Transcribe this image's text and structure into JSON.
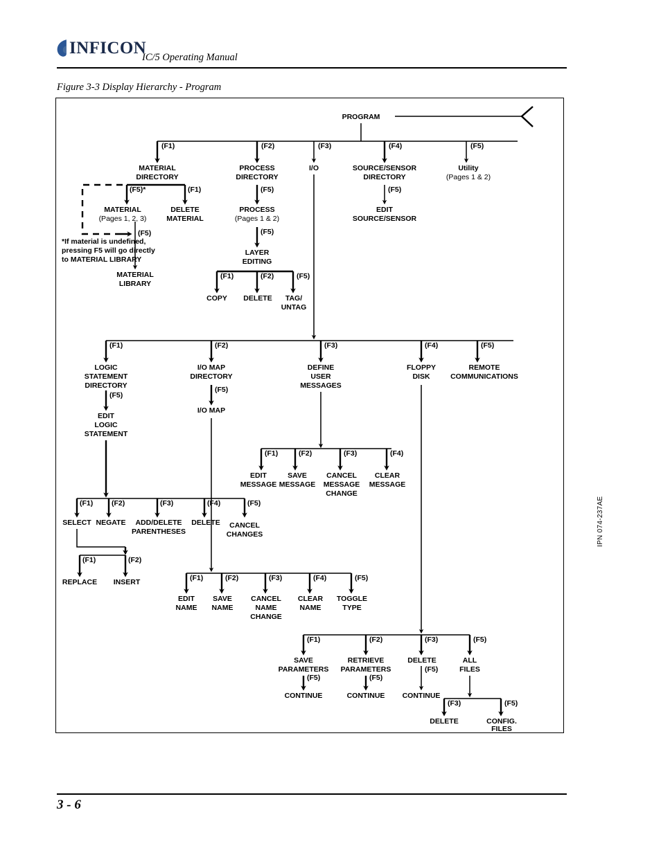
{
  "header": {
    "brand": "INFICON",
    "manual_title": "IC/5 Operating Manual",
    "logo_color": "#2b5796",
    "wordmark_color": "#1b2b4b"
  },
  "figure": {
    "caption": "Figure 3-3  Display Hierarchy - Program",
    "footnote_line1": "*If material is undefined,",
    "footnote_line2": "pressing F5 will go directly",
    "footnote_line3": "to MATERIAL LIBRARY"
  },
  "footer": {
    "page_number": "3 - 6",
    "side_code": "IPN 074-237AE"
  },
  "keys": {
    "f1": "(F1)",
    "f2": "(F2)",
    "f3": "(F3)",
    "f4": "(F4)",
    "f5": "(F5)",
    "f5_star": "(F5)*"
  },
  "nodes": {
    "program": "PROGRAM",
    "material_directory_l1": "MATERIAL",
    "material_directory_l2": "DIRECTORY",
    "process_directory_l1": "PROCESS",
    "process_directory_l2": "DIRECTORY",
    "io": "I/O",
    "source_sensor_directory_l1": "SOURCE/SENSOR",
    "source_sensor_directory_l2": "DIRECTORY",
    "utility_l1": "Utility",
    "utility_l2": "(Pages 1 & 2)",
    "material_l1": "MATERIAL",
    "material_l2": "(Pages 1, 2, 3)",
    "delete_material_l1": "DELETE",
    "delete_material_l2": "MATERIAL",
    "process_l1": "PROCESS",
    "process_l2": "(Pages 1 & 2)",
    "edit_source_sensor_l1": "EDIT",
    "edit_source_sensor_l2": "SOURCE/SENSOR",
    "material_library_l1": "MATERIAL",
    "material_library_l2": "LIBRARY",
    "layer_editing_l1": "LAYER",
    "layer_editing_l2": "EDITING",
    "copy": "COPY",
    "delete_layer": "DELETE",
    "tag_untag_l1": "TAG/",
    "tag_untag_l2": "UNTAG",
    "logic_statement_directory_l1": "LOGIC",
    "logic_statement_directory_l2": "STATEMENT",
    "logic_statement_directory_l3": "DIRECTORY",
    "io_map_directory_l1": "I/O MAP",
    "io_map_directory_l2": "DIRECTORY",
    "define_user_messages_l1": "DEFINE",
    "define_user_messages_l2": "USER",
    "define_user_messages_l3": "MESSAGES",
    "floppy_disk_l1": "FLOPPY",
    "floppy_disk_l2": "DISK",
    "remote_communications_l1": "REMOTE",
    "remote_communications_l2": "COMMUNICATIONS",
    "edit_logic_statement_l1": "EDIT",
    "edit_logic_statement_l2": "LOGIC",
    "edit_logic_statement_l3": "STATEMENT",
    "io_map": "I/O MAP",
    "edit_message_l1": "EDIT",
    "edit_message_l2": "MESSAGE",
    "save_message_l1": "SAVE",
    "save_message_l2": "MESSAGE",
    "cancel_message_change_l1": "CANCEL",
    "cancel_message_change_l2": "MESSAGE",
    "cancel_message_change_l3": "CHANGE",
    "clear_message_l1": "CLEAR",
    "clear_message_l2": "MESSAGE",
    "select": "SELECT",
    "negate": "NEGATE",
    "add_delete_parentheses_l1": "ADD/DELETE",
    "add_delete_parentheses_l2": "PARENTHESES",
    "delete_logic": "DELETE",
    "cancel_changes_l1": "CANCEL",
    "cancel_changes_l2": "CHANGES",
    "replace": "REPLACE",
    "insert": "INSERT",
    "edit_name_l1": "EDIT",
    "edit_name_l2": "NAME",
    "save_name_l1": "SAVE",
    "save_name_l2": "NAME",
    "cancel_name_change_l1": "CANCEL",
    "cancel_name_change_l2": "NAME",
    "cancel_name_change_l3": "CHANGE",
    "clear_name_l1": "CLEAR",
    "clear_name_l2": "NAME",
    "toggle_type_l1": "TOGGLE",
    "toggle_type_l2": "TYPE",
    "save_parameters_l1": "SAVE",
    "save_parameters_l2": "PARAMETERS",
    "retrieve_parameters_l1": "RETRIEVE",
    "retrieve_parameters_l2": "PARAMETERS",
    "delete_file": "DELETE",
    "all_files_l1": "ALL",
    "all_files_l2": "FILES",
    "continue_save": "CONTINUE",
    "continue_retrieve": "CONTINUE",
    "continue_delete": "CONTINUE",
    "delete_all": "DELETE",
    "config_files_l1": "CONFIG.",
    "config_files_l2": "FILES"
  }
}
